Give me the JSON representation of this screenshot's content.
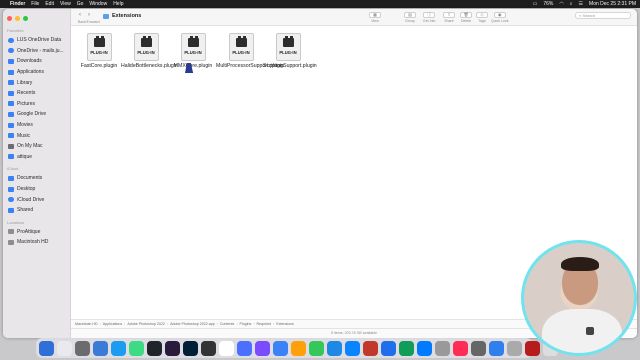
{
  "menubar": {
    "app_name": "Finder",
    "items": [
      "File",
      "Edit",
      "View",
      "Go",
      "Window",
      "Help"
    ],
    "status": {
      "battery": "76%",
      "datetime": "Mon Dec 25  2:31 PM"
    }
  },
  "window": {
    "title": "Extensions"
  },
  "toolbar": {
    "nav_label": "Back/Forward",
    "groups": [
      "View",
      "Group",
      "Get Info",
      "Share",
      "Delete",
      "Tags",
      "Quick Look"
    ],
    "search_label": "Search",
    "search_placeholder": "Search"
  },
  "sidebar": {
    "sections": [
      {
        "title": "Favorites",
        "items": [
          "LUS OneDrive Data",
          "OneDrive - mails.ju...",
          "Downloads",
          "Applications",
          "Library",
          "Recents",
          "Pictures",
          "Google Drive",
          "Movies",
          "Music",
          "On My Mac",
          "attique"
        ]
      },
      {
        "title": "iCloud",
        "items": [
          "Documents",
          "Desktop",
          "iCloud Drive",
          "Shared"
        ]
      },
      {
        "title": "Locations",
        "items": [
          "ProAttique",
          "Macintosh HD"
        ]
      }
    ]
  },
  "files": [
    {
      "tag": "PLUG-IN",
      "name": "FastCore.plugin"
    },
    {
      "tag": "PLUG-IN",
      "name": "HalideBottlenecks.plugin"
    },
    {
      "tag": "PLUG-IN",
      "name": "MMXCore.plugin"
    },
    {
      "tag": "PLUG-IN",
      "name": "MultiProcessorSupport.plugin"
    },
    {
      "tag": "PLUG-IN",
      "name": "ScriptingSupport.plugin"
    }
  ],
  "pathbar": [
    "Macintosh HD",
    "Applications",
    "Adobe Photoshop 2022",
    "Adobe Photoshop 2022.app",
    "Contents",
    "Plugins",
    "Required",
    "Extensions"
  ],
  "statusbar": "5 items, 203.76 GB available",
  "dock": {
    "app_colors": [
      "#2f6fd6",
      "#e9e9ee",
      "#6b6b70",
      "#3a7bd5",
      "#1d9bf0",
      "#3ddc84",
      "#20252b",
      "#2a1b3d",
      "#001e36",
      "#333",
      "#fff",
      "#4b6fff",
      "#7a4bff",
      "#3b82f6",
      "#ff9f0a",
      "#34c759",
      "#1e88e5",
      "#0a84ff",
      "#c0392b",
      "#1f6feb",
      "#0f9d58",
      "#007aff",
      "#999",
      "#ff2d55",
      "#666",
      "#2f80ed",
      "#aaa",
      "#b71c1c",
      "#ddd",
      "#ccc"
    ]
  }
}
